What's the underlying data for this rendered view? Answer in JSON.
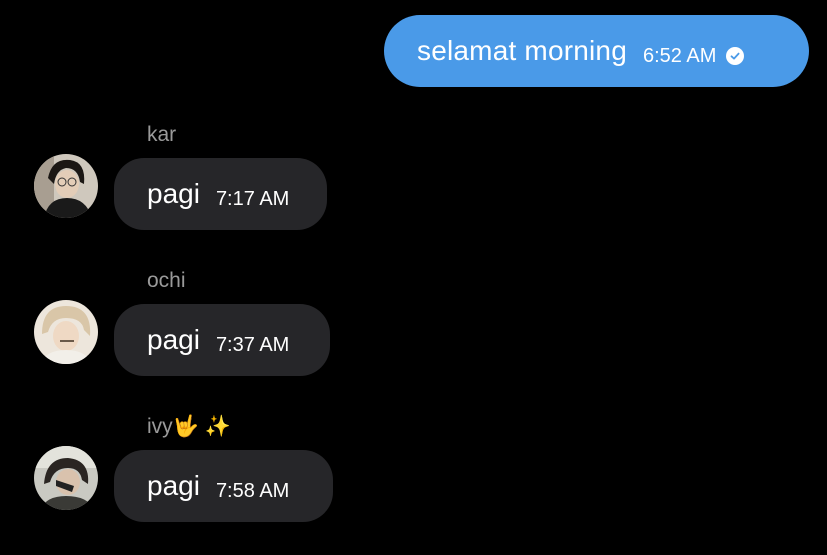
{
  "outgoing": {
    "text": "selamat morning",
    "time": "6:52 AM",
    "status_icon": "read-check-icon",
    "bubble_color": "#4a9ae8"
  },
  "messages": [
    {
      "sender": "kar",
      "text": "pagi",
      "time": "7:17 AM"
    },
    {
      "sender": "ochi",
      "text": "pagi",
      "time": "7:37 AM"
    },
    {
      "sender": "ivy🤟 ✨",
      "text": "pagi",
      "time": "7:58 AM"
    }
  ],
  "colors": {
    "background": "#000000",
    "incoming_bubble": "#262629",
    "sender_name": "#9a9a9a"
  }
}
